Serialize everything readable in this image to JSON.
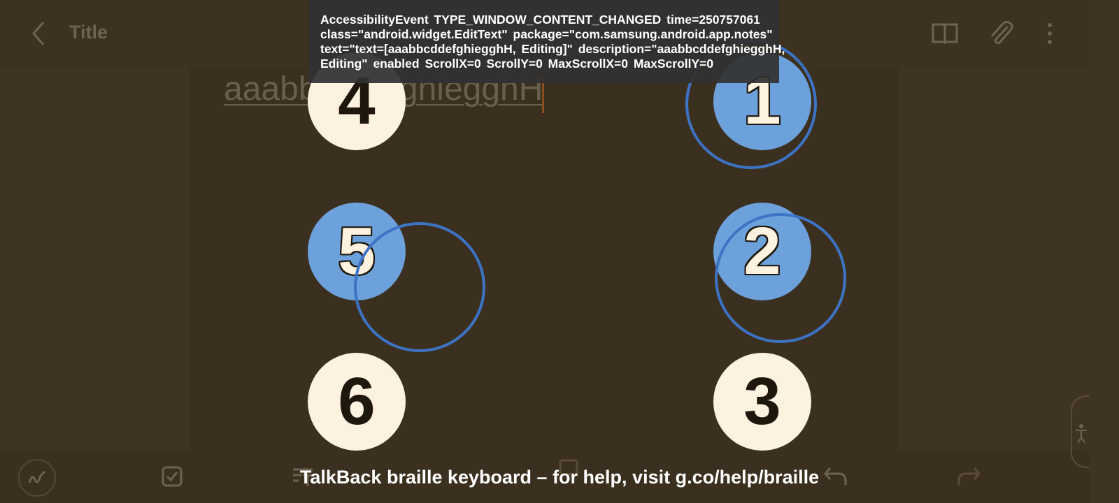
{
  "header": {
    "title": "Title",
    "icons": [
      "back-arrow-icon",
      "reading-mode-book-icon",
      "attachment-paperclip-icon",
      "more-options-icon"
    ]
  },
  "note": {
    "body_text": "aaabbcddefghiegghH"
  },
  "toolbar": {
    "icons": [
      "pen-drawing-icon",
      "checkbox-icon",
      "text-format-icon",
      "insert-icon",
      "image-icon",
      "voice-icon",
      "undo-icon",
      "redo-icon"
    ]
  },
  "braille_keyboard": {
    "dots": [
      {
        "label": "1",
        "state": "active"
      },
      {
        "label": "2",
        "state": "active"
      },
      {
        "label": "3",
        "state": "idle"
      },
      {
        "label": "4",
        "state": "idle"
      },
      {
        "label": "5",
        "state": "active"
      },
      {
        "label": "6",
        "state": "idle"
      }
    ],
    "hint": "TalkBack braille keyboard – for help, visit g.co/help/braille"
  },
  "accessibility_event": {
    "lines": [
      "AccessibilityEvent TYPE_WINDOW_CONTENT_CHANGED time=250757061",
      "class=\"android.widget.EditText\" package=\"com.samsung.android.app.notes\"",
      "text=\"text=[aaabbcddefghiegghH, Editing]\" description=\"aaabbcddefghiegghH,",
      "Editing\" enabled ScrollX=0 ScrollY=0 MaxScrollX=0 MaxScrollY=0"
    ]
  },
  "colors": {
    "background": "#3f3321",
    "dot_idle": "#fdf1df",
    "dot_active": "#6da1dc",
    "touch_ring": "#3d73c4",
    "overlay": "#313131"
  }
}
